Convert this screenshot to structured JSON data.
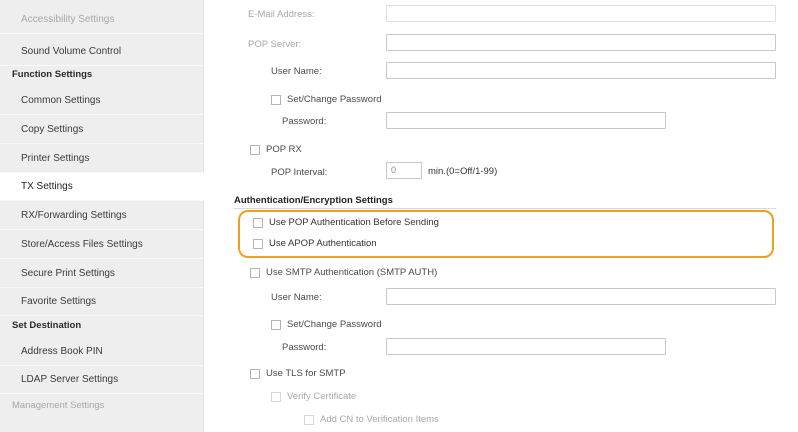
{
  "sidebar": {
    "items": [
      {
        "label": "Accessibility Settings"
      },
      {
        "label": "Sound Volume Control"
      },
      {
        "heading": "Function Settings"
      },
      {
        "label": "Common Settings"
      },
      {
        "label": "Copy Settings"
      },
      {
        "label": "Printer Settings"
      },
      {
        "label": "TX Settings",
        "selected": true
      },
      {
        "label": "RX/Forwarding Settings"
      },
      {
        "label": "Store/Access Files Settings"
      },
      {
        "label": "Secure Print Settings"
      },
      {
        "label": "Favorite Settings"
      },
      {
        "heading": "Set Destination"
      },
      {
        "label": "Address Book PIN"
      },
      {
        "label": "LDAP Server Settings"
      },
      {
        "heading": "Management Settings"
      }
    ]
  },
  "form": {
    "email_address_label": "E-Mail Address:",
    "pop_server_label": "POP Server:",
    "pop_user_name_label": "User Name:",
    "pop_set_change_password_label": "Set/Change Password",
    "pop_password_label": "Password:",
    "pop_rx_label": "POP RX",
    "pop_interval_label": "POP Interval:",
    "pop_interval_value": "0",
    "pop_interval_unit": "min.(0=Off/1-99)",
    "auth_section_title": "Authentication/Encryption Settings",
    "use_pop_auth_label": "Use POP Authentication Before Sending",
    "use_apop_label": "Use APOP Authentication",
    "use_smtp_auth_label": "Use SMTP Authentication (SMTP AUTH)",
    "smtp_user_name_label": "User Name:",
    "smtp_set_change_password_label": "Set/Change Password",
    "smtp_password_label": "Password:",
    "use_tls_label": "Use TLS for SMTP",
    "verify_certificate_label": "Verify Certificate",
    "add_cn_label": "Add CN to Verification Items"
  },
  "colors": {
    "highlight": "#f0a020",
    "sidebar_bg": "#eeeeee"
  }
}
